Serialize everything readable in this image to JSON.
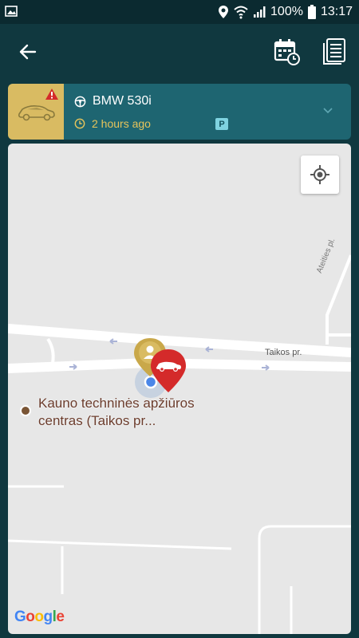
{
  "status_bar": {
    "battery": "100%",
    "time": "13:17"
  },
  "toolbar": {
    "back_icon": "arrow-left-icon",
    "history_icon": "calendar-clock-icon",
    "log_icon": "document-icon"
  },
  "vehicle": {
    "name": "BMW 530i",
    "last_seen": "2 hours ago",
    "parking_badge": "P",
    "thumb_color": "#d9bb62",
    "card_color": "#1e6571"
  },
  "map": {
    "street_main": "Taikos pr.",
    "street_side": "Ateities pl.",
    "poi_line1": "Kauno techninės apžiūros",
    "poi_line2": "centras (Taikos pr...",
    "logo": "Google",
    "locate_icon": "crosshair-icon"
  },
  "colors": {
    "header_bg": "#10383f",
    "accent_yellow": "#e6c45b",
    "car_pin": "#d42a2a",
    "user_pin": "#c9a84a"
  }
}
